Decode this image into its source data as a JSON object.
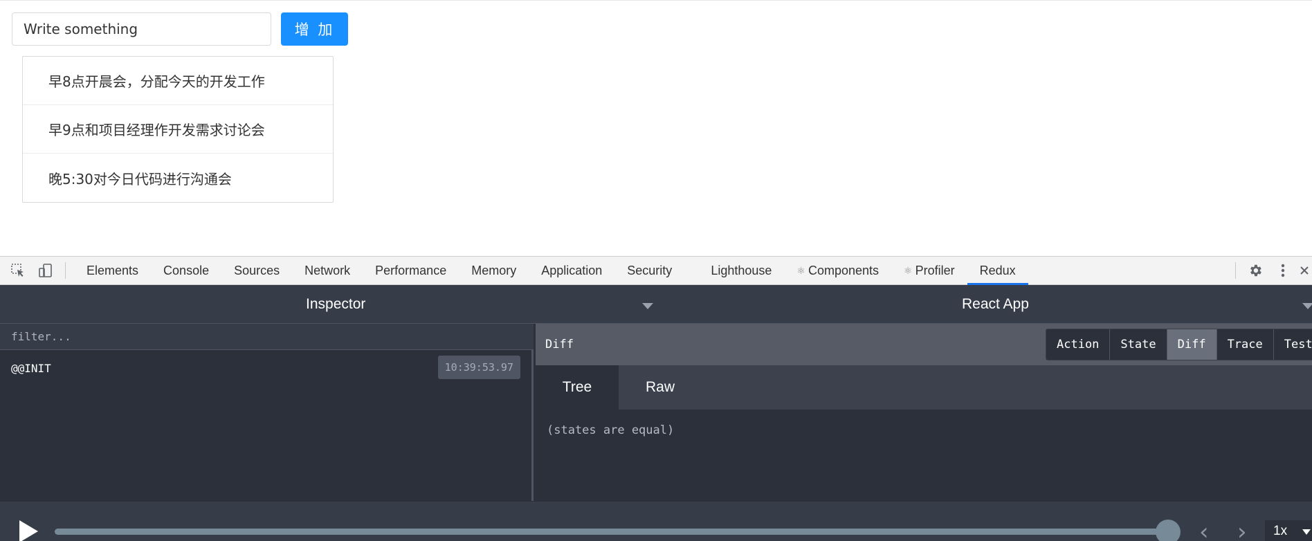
{
  "app": {
    "input": {
      "placeholder": "Write something",
      "value": ""
    },
    "add_button": "增 加",
    "todos": [
      "早8点开晨会，分配今天的开发工作",
      "早9点和项目经理作开发需求讨论会",
      "晚5:30对今日代码进行沟通会"
    ]
  },
  "devtools": {
    "tabs": [
      "Elements",
      "Console",
      "Sources",
      "Network",
      "Performance",
      "Memory",
      "Application",
      "Security",
      "Lighthouse",
      "Components",
      "Profiler",
      "Redux"
    ],
    "active_tab": "Redux",
    "icons": [
      "inspect-element-icon",
      "device-toolbar-icon",
      "settings-gear-icon",
      "more-vertical-icon",
      "close-icon"
    ]
  },
  "redux": {
    "left_header": "Inspector",
    "right_header": "React App",
    "filter_placeholder": "filter...",
    "actions": [
      {
        "name": "@@INIT",
        "time": "10:39:53.97"
      }
    ],
    "diff_label": "Diff",
    "monitor_buttons": [
      "Action",
      "State",
      "Diff",
      "Trace",
      "Test"
    ],
    "active_monitor": "Diff",
    "subtabs": [
      "Tree",
      "Raw"
    ],
    "active_subtab": "Tree",
    "message": "(states are equal)",
    "slider": {
      "position": 1.0,
      "speed": "1x"
    }
  },
  "colors": {
    "accent": "#1890ff",
    "devtools_active": "#1a73e8",
    "redux_bg": "#2b303b",
    "slider": "#768a98"
  }
}
